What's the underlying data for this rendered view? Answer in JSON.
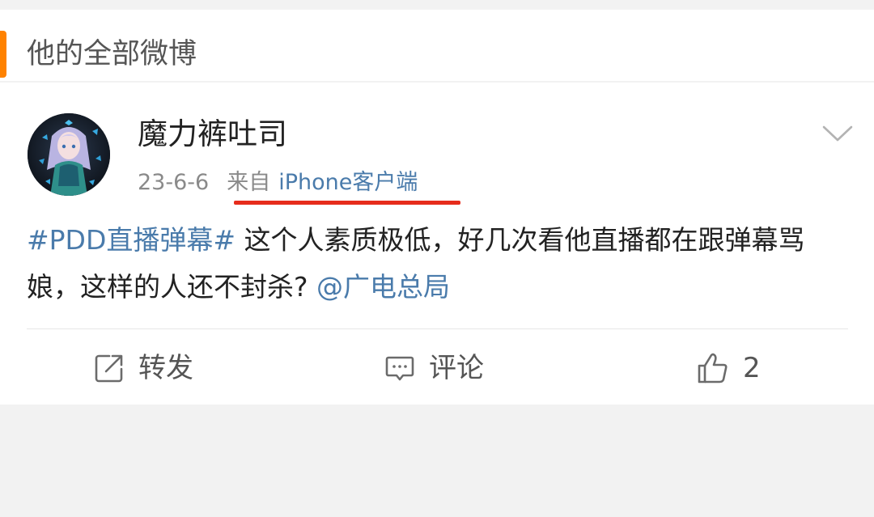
{
  "header": {
    "title": "他的全部微博",
    "accent_color": "#ff8200"
  },
  "post": {
    "author": "魔力裤吐司",
    "avatar_icon": "anime-character-avatar",
    "time": "23-6-6",
    "via_prefix": "来自",
    "via_source": "iPhone客户端",
    "annotation_color": "#e62c1c",
    "text": {
      "topic": "#PDD直播弹幕#",
      "body": " 这个人素质极低，好几次看他直播都在跟弹幕骂娘，这样的人还不封杀? ",
      "mention": "@广电总局"
    },
    "link_color": "#4a7bab"
  },
  "actions": {
    "repost_label": "转发",
    "comment_label": "评论",
    "like_count": "2"
  }
}
